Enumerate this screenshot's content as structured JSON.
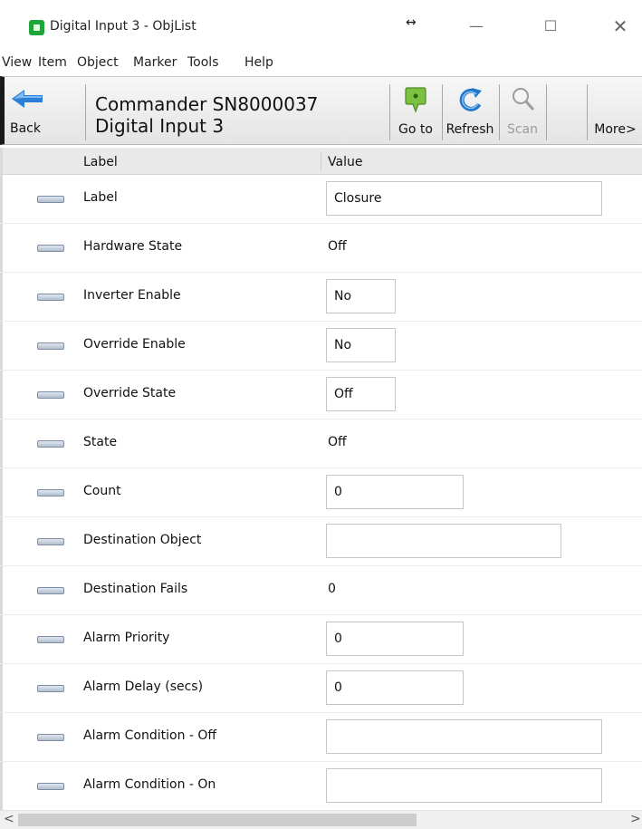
{
  "window": {
    "title": "Digital Input 3 - ObjList",
    "resize_glyph": "↔",
    "minimize": "—",
    "maximize": "☐",
    "close": "✕"
  },
  "menu": [
    "View",
    "Item",
    "Object",
    "Marker",
    "Tools",
    "Help"
  ],
  "toolbar": {
    "back_label": "Back",
    "object_line1": "Commander SN8000037",
    "object_line2": "Digital Input 3",
    "goto_label": "Go to",
    "refresh_label": "Refresh",
    "scan_label": "Scan",
    "more_label": "More>"
  },
  "columns": {
    "label": "Label",
    "value": "Value"
  },
  "rows": [
    {
      "label": "Label",
      "value": "Closure"
    },
    {
      "label": "Hardware State",
      "value": "Off"
    },
    {
      "label": "Inverter Enable",
      "value": "No"
    },
    {
      "label": "Override Enable",
      "value": "No"
    },
    {
      "label": "Override State",
      "value": "Off"
    },
    {
      "label": "State",
      "value": "Off"
    },
    {
      "label": "Count",
      "value": "0"
    },
    {
      "label": "Destination Object",
      "value": ""
    },
    {
      "label": "Destination Fails",
      "value": "0"
    },
    {
      "label": "Alarm Priority",
      "value": "0"
    },
    {
      "label": "Alarm Delay (secs)",
      "value": "0"
    },
    {
      "label": "Alarm Condition - Off",
      "value": ""
    },
    {
      "label": "Alarm Condition - On",
      "value": ""
    }
  ],
  "scrollbar": {
    "left_arrow": "<",
    "right_arrow": ">"
  },
  "colors": {
    "app_icon": "#1fa53a",
    "back_arrow": "#2b7fd6",
    "goto_icon": "#7cc242",
    "refresh_icon": "#2277cc"
  }
}
